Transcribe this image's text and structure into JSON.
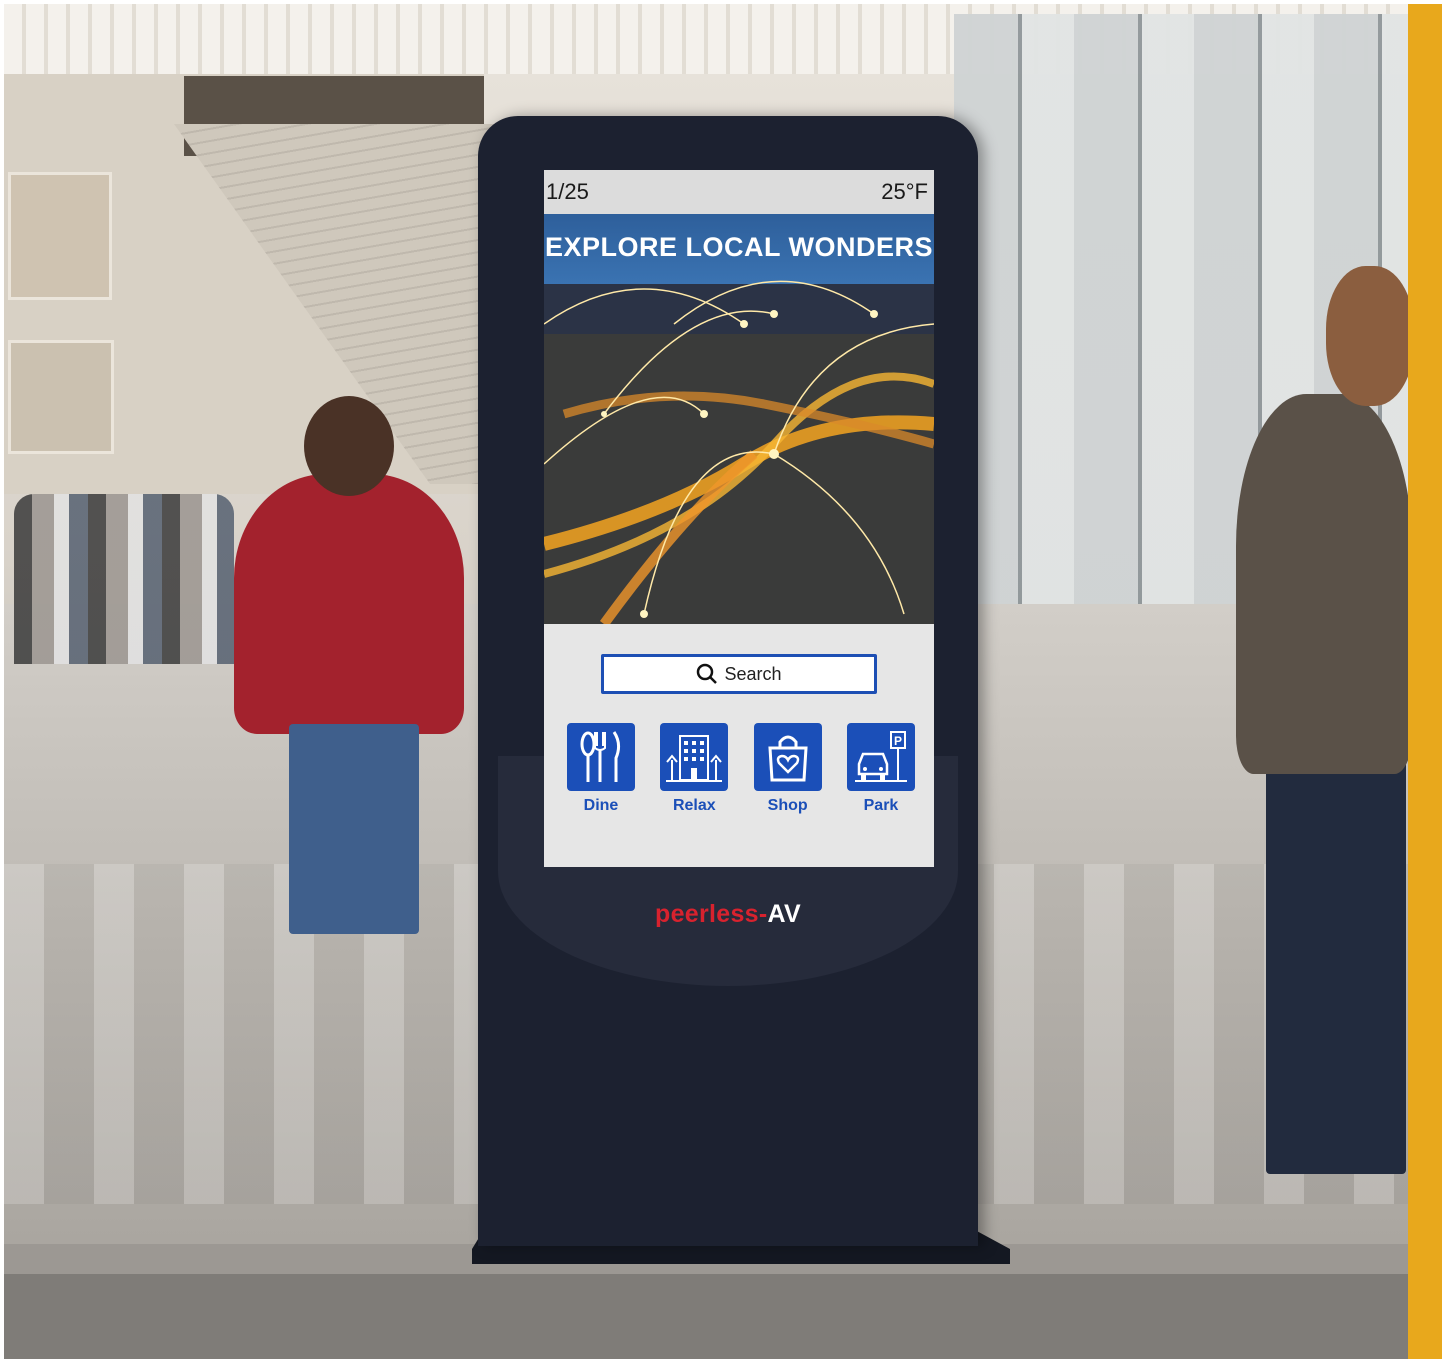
{
  "colors": {
    "accent_bar": "#e8a81c",
    "kiosk_body": "#1c2130",
    "screen_blue": "#1b4fb8",
    "brand_red": "#d8222e"
  },
  "screen": {
    "status_left": "1/25",
    "status_right": "25°F",
    "hero_title": "EXPLORE LOCAL WONDERS",
    "search_label": "Search",
    "search_icon": "search-icon",
    "tiles": [
      {
        "label": "Dine",
        "icon": "fork-knife-icon"
      },
      {
        "label": "Relax",
        "icon": "hotel-icon"
      },
      {
        "label": "Shop",
        "icon": "shopping-bag-icon"
      },
      {
        "label": "Park",
        "icon": "parking-car-icon"
      }
    ]
  },
  "brand": {
    "name": "peerless-",
    "suffix": "AV"
  }
}
